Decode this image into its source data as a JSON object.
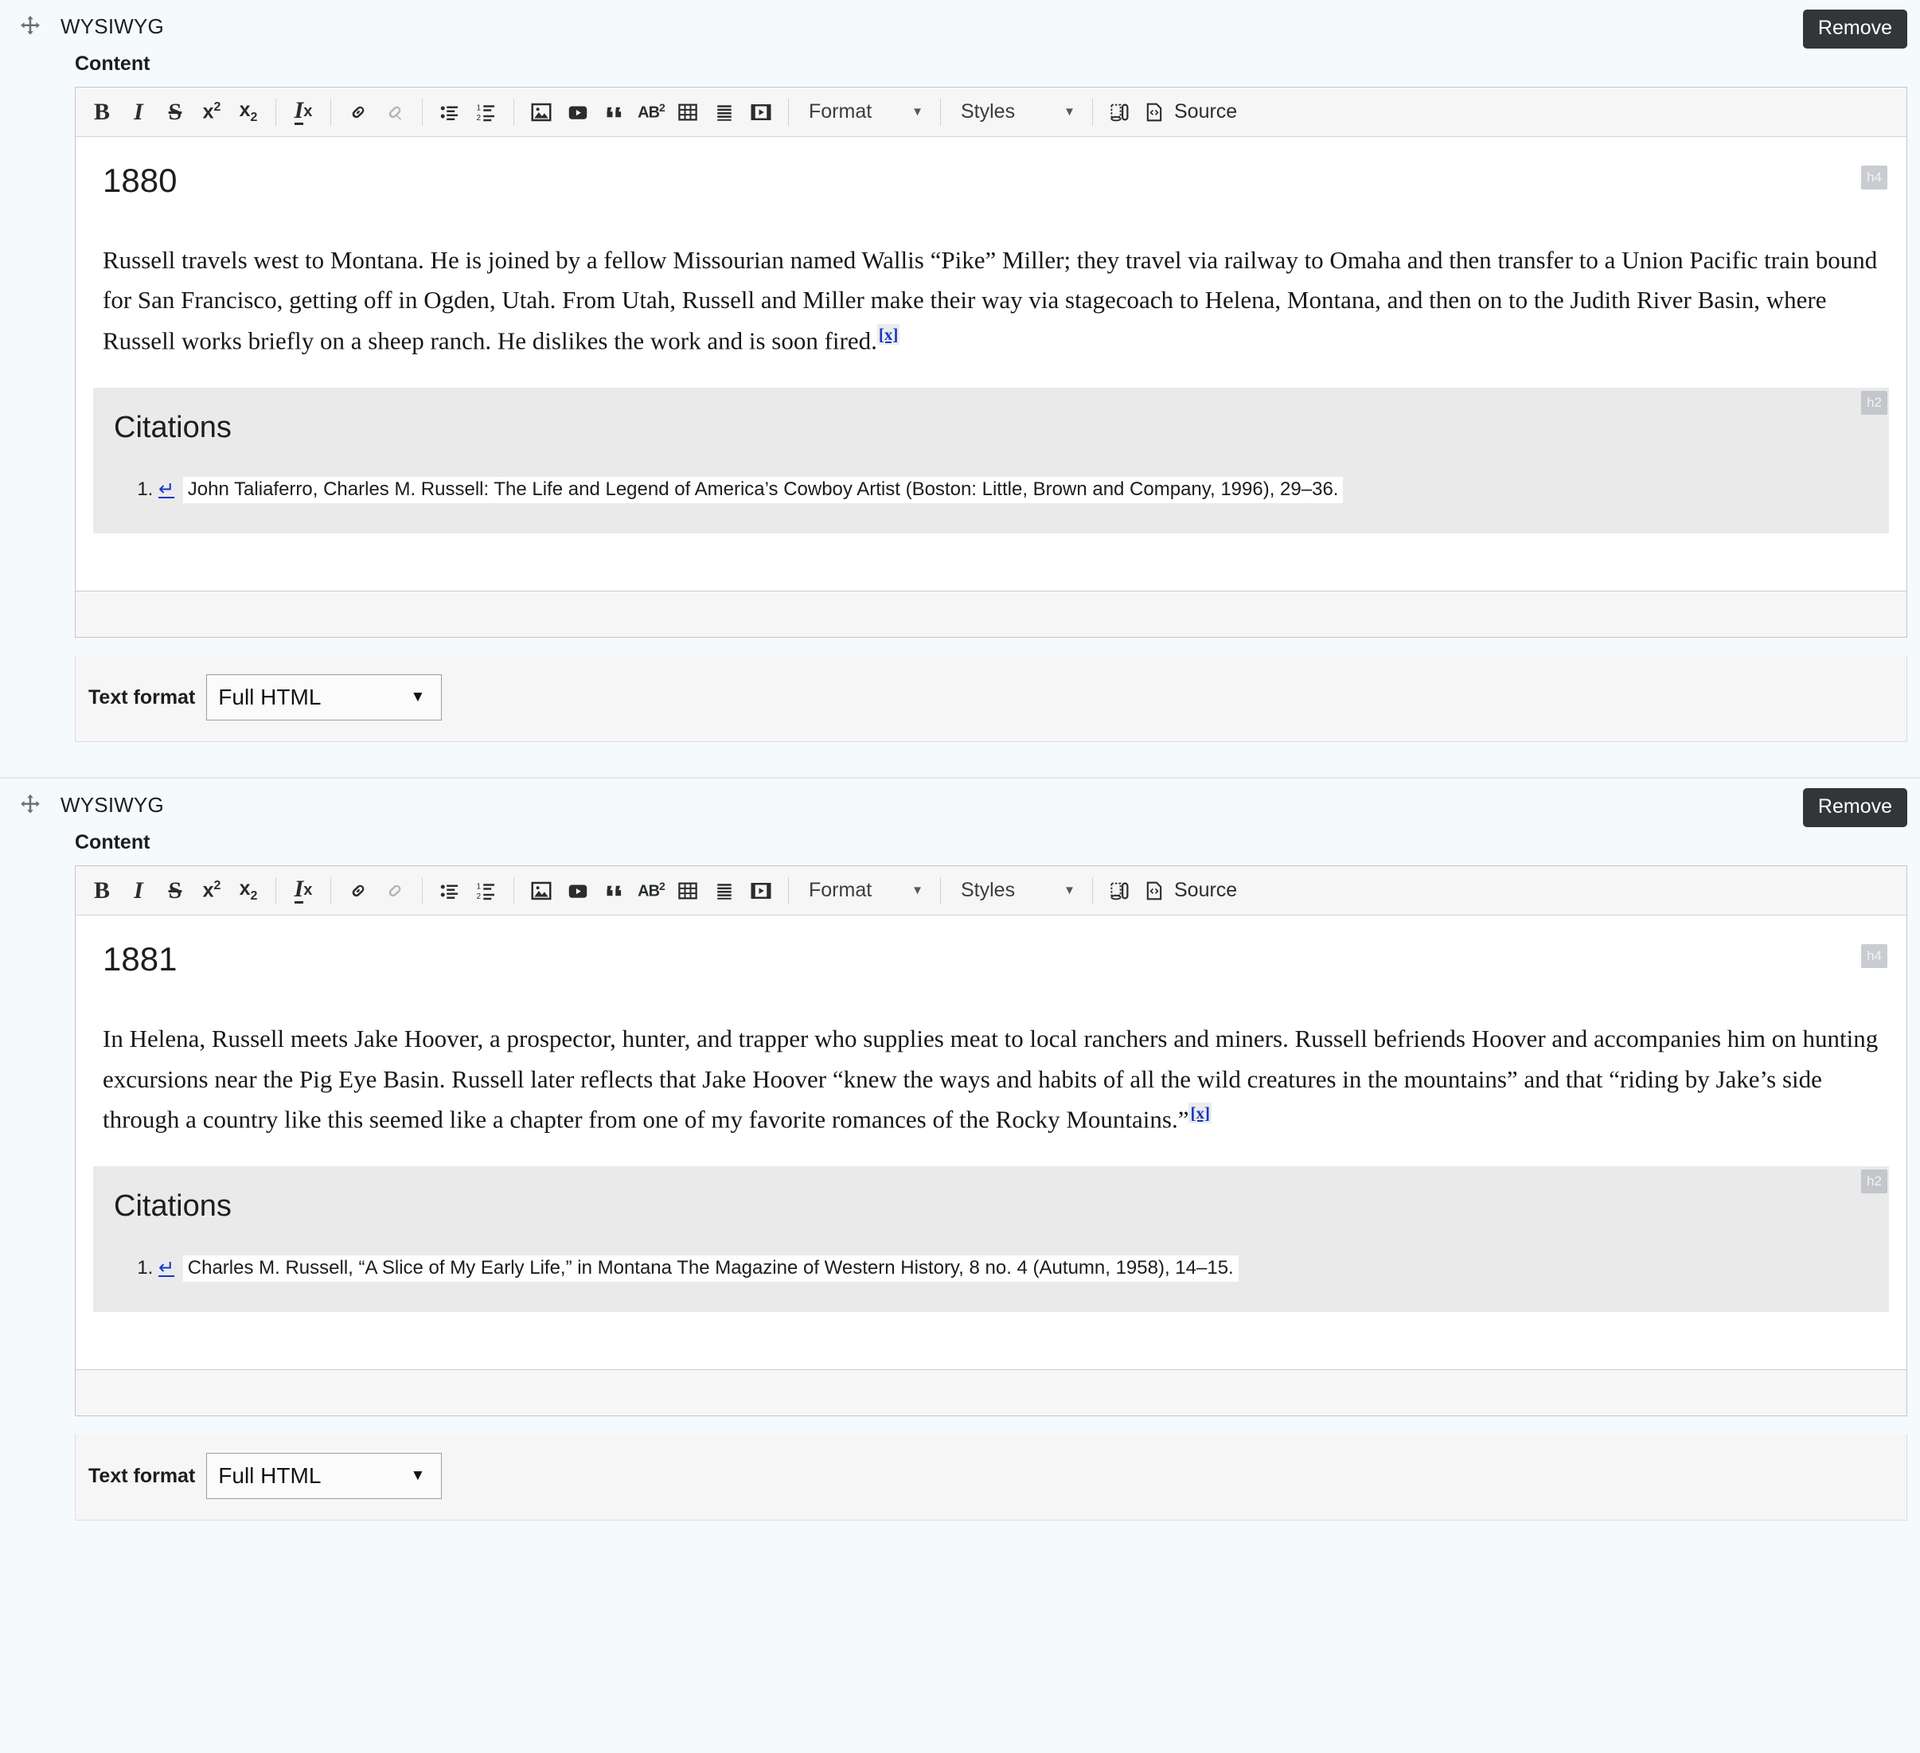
{
  "theme": {
    "page_background": "#f5fafd",
    "toolbar_background": "#f6f6f6",
    "citations_background": "#eaeaea",
    "remove_button_background": "#333639",
    "link_color": "#1535c8",
    "block_tag_background": "#c9ccd0"
  },
  "toolbar": {
    "buttons": [
      {
        "name": "bold",
        "glyph": "B"
      },
      {
        "name": "italic",
        "glyph": "I"
      },
      {
        "name": "strikethrough",
        "glyph": "S"
      },
      {
        "name": "superscript",
        "glyph": "x²"
      },
      {
        "name": "subscript",
        "glyph": "x₂"
      }
    ],
    "remove_format_glyph": "I",
    "remove_format_sub": "x",
    "link_label": "Link",
    "unlink_label": "Unlink",
    "bulleted_list_label": "Insert/Remove Bulleted List",
    "numbered_list_label": "Insert/Remove Numbered List",
    "image_label": "Image",
    "video_label": "Video",
    "blockquote_label": "Block Quote",
    "abbr_label": "AB²",
    "table_label": "Table",
    "horizontal_rule_label": "Horizontal Line",
    "media_label": "Media",
    "format_label": "Format",
    "styles_label": "Styles",
    "templates_label": "Templates",
    "source_label": "Source",
    "caret_glyph": "▼"
  },
  "sections": [
    {
      "row_label": "WYSIWYG",
      "remove_label": "Remove",
      "content_label": "Content",
      "block_tag_heading": "h4",
      "block_tag_citations": "h2",
      "year": "1880",
      "body": "Russell travels west to Montana. He is joined by a fellow Missourian named Wallis “Pike” Miller; they travel via railway to Omaha and then transfer to a Union Pacific train bound for San Francisco, getting off in Ogden, Utah. From Utah, Russell and Miller make their way via stagecoach to Helena, Montana, and then on to the Judith River Basin, where Russell works briefly on a sheep ranch. He dislikes the work and is soon fired.",
      "footnote_marker": "[x]",
      "citations_title": "Citations",
      "citations": [
        {
          "backref": "↵",
          "text": "John Taliaferro, Charles M. Russell: The Life and Legend of America’s Cowboy Artist (Boston: Little, Brown and Company, 1996), 29–36."
        }
      ],
      "text_format_label": "Text format",
      "text_format_value": "Full HTML"
    },
    {
      "row_label": "WYSIWYG",
      "remove_label": "Remove",
      "content_label": "Content",
      "block_tag_heading": "h4",
      "block_tag_citations": "h2",
      "year": "1881",
      "body": "In Helena, Russell meets Jake Hoover, a prospector, hunter, and trapper who supplies meat to local ranchers and miners. Russell befriends Hoover and accompanies him on hunting excursions near the Pig Eye Basin. Russell later reflects that Jake Hoover “knew the ways and habits of all the wild creatures in the mountains” and that “riding by Jake’s side through a country like this seemed like a chapter from one of my favorite romances of the Rocky Mountains.”",
      "footnote_marker": "[x]",
      "citations_title": "Citations",
      "citations": [
        {
          "backref": "↵",
          "text": "Charles M. Russell, “A Slice of My Early Life,” in Montana The Magazine of Western History, 8 no. 4 (Autumn, 1958), 14–15."
        }
      ],
      "text_format_label": "Text format",
      "text_format_value": "Full HTML"
    }
  ]
}
